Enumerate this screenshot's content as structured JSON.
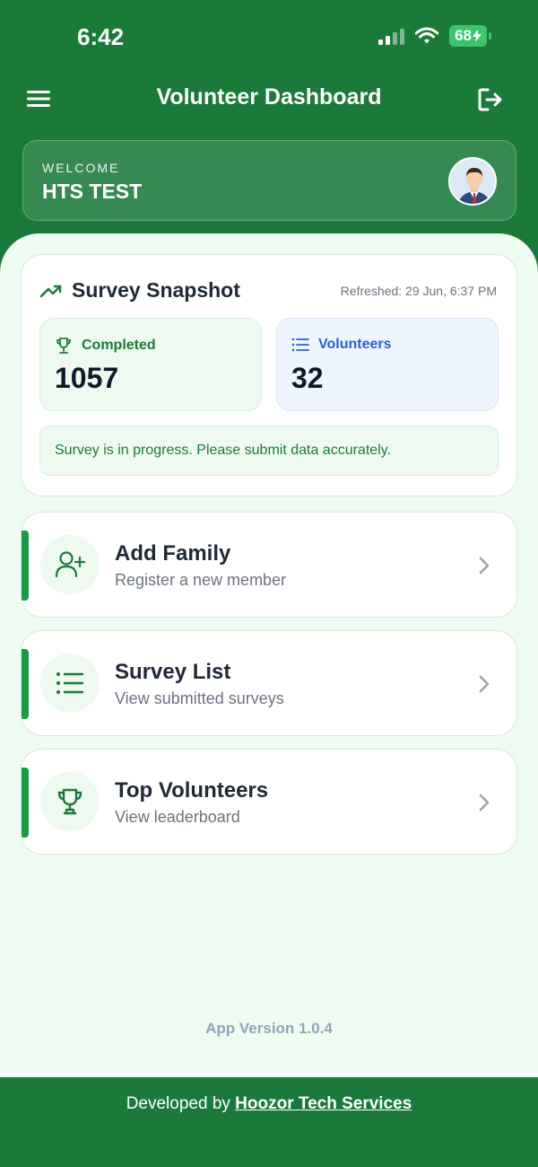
{
  "status": {
    "time": "6:42",
    "battery": "68"
  },
  "header": {
    "title": "Volunteer Dashboard"
  },
  "welcome": {
    "label": "WELCOME",
    "name": "HTS TEST"
  },
  "snapshot": {
    "title": "Survey Snapshot",
    "refreshed": "Refreshed: 29 Jun, 6:37 PM",
    "completed": {
      "label": "Completed",
      "value": "1057"
    },
    "volunteers": {
      "label": "Volunteers",
      "value": "32"
    },
    "notice": "Survey is in progress. Please submit data accurately."
  },
  "actions": [
    {
      "title": "Add Family",
      "subtitle": "Register a new member",
      "icon": "add-user-icon"
    },
    {
      "title": "Survey List",
      "subtitle": "View submitted surveys",
      "icon": "list-icon"
    },
    {
      "title": "Top Volunteers",
      "subtitle": "View leaderboard",
      "icon": "trophy-icon"
    }
  ],
  "version": "App Version 1.0.4",
  "footer": {
    "prefix": "Developed by ",
    "link": "Hoozor Tech Services"
  },
  "colors": {
    "primary": "#1b7a3a",
    "accent": "#1b9a45",
    "blue": "#2962c4",
    "background": "#effcf1"
  }
}
